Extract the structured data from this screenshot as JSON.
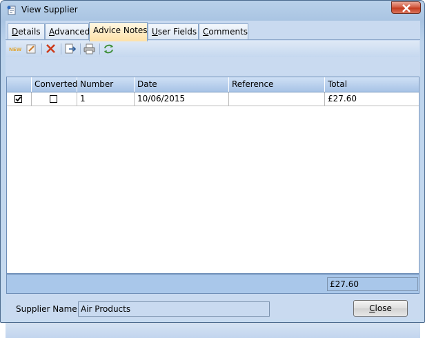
{
  "window": {
    "title": "View Supplier"
  },
  "tabs": [
    {
      "label": "Details",
      "accel": "D",
      "rest": "etails"
    },
    {
      "label": "Advanced",
      "accel": "A",
      "rest": "dvanced"
    },
    {
      "label": "Advice Notes",
      "accel": "",
      "rest": "Advice Notes"
    },
    {
      "label": "User Fields",
      "accel": "U",
      "rest": "ser Fields"
    },
    {
      "label": "Comments",
      "accel": "C",
      "rest": "omments"
    }
  ],
  "active_tab": "Advice Notes",
  "toolbar": {
    "new_label": "NEW"
  },
  "grid": {
    "columns": [
      "",
      "Converted",
      "Number",
      "Date",
      "Reference",
      "Total"
    ],
    "rows": [
      {
        "selected": true,
        "converted": false,
        "number": "1",
        "date": "10/06/2015",
        "reference": "",
        "total": "£27.60"
      }
    ],
    "footer_total": "£27.60"
  },
  "supplier": {
    "label": "Supplier Name",
    "value": "Air Products"
  },
  "close_button": {
    "accel": "C",
    "rest": "lose"
  }
}
